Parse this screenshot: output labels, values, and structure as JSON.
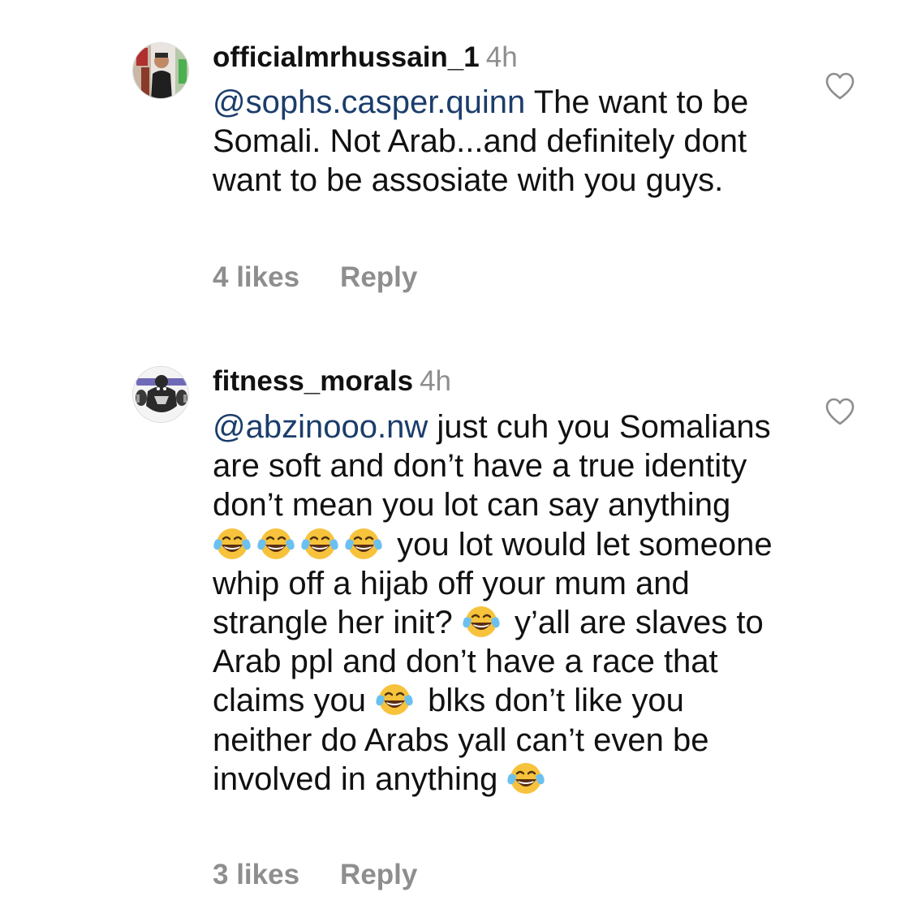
{
  "comments": [
    {
      "username": "officialmrhussain_1",
      "time": "4h",
      "mention": "@sophs.casper.quinn",
      "segments": [
        " The want to be Somali. Not Arab...and definitely dont want to be assosiate with you guys."
      ],
      "likes": "4 likes",
      "reply": "Reply",
      "avatar_icon": "person-photo-icon",
      "like_icon": "heart-outline-icon"
    },
    {
      "username": "fitness_morals",
      "time": "4h",
      "mention": "@abzinooo.nw",
      "segments": [
        " just cuh you Somalians are soft and don’t have a true identity don’t mean you lot can say anything ",
        " you lot would let someone whip off a hijab off your mum and strangle her init? ",
        " y’all are slaves to Arab ppl and don’t have a race that claims you ",
        " blks don’t like you neither do Arabs yall can’t even be involved in anything ",
        ""
      ],
      "emoji": "😂",
      "emoji_name": "tears-of-joy-emoji",
      "likes": "3 likes",
      "reply": "Reply",
      "avatar_icon": "gorilla-logo-icon",
      "like_icon": "heart-outline-icon"
    }
  ],
  "colors": {
    "text": "#111111",
    "muted": "#8e8e8e",
    "mention": "#1b3d6b",
    "background": "#ffffff"
  }
}
